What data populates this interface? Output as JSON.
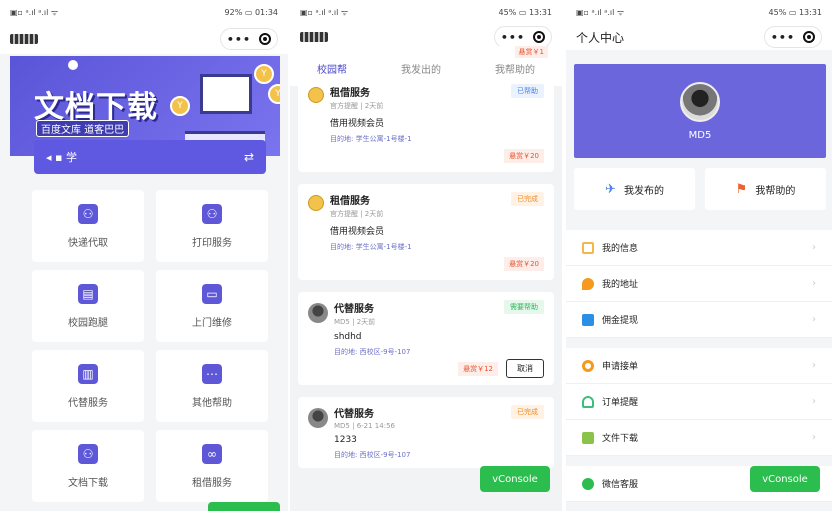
{
  "panel1": {
    "status_left": "▣▫ ᵃ.ıl ᵃ.ıl ᯤ",
    "status_right": "92% ▭ 01:34",
    "banner": {
      "title": "文档下载",
      "subtitle": "百度文库 道客巴巴",
      "coin": "Y"
    },
    "location": {
      "text": "学",
      "swap": "⇄"
    },
    "services": [
      {
        "label": "快递代取",
        "icon": "person-icon"
      },
      {
        "label": "打印服务",
        "icon": "person-icon"
      },
      {
        "label": "校园跑腿",
        "icon": "printer-icon"
      },
      {
        "label": "上门维修",
        "icon": "monitor-icon"
      },
      {
        "label": "代替服务",
        "icon": "book-icon"
      },
      {
        "label": "其他帮助",
        "icon": "more-icon"
      },
      {
        "label": "文档下载",
        "icon": "person-icon"
      },
      {
        "label": "租借服务",
        "icon": "glasses-icon"
      }
    ]
  },
  "panel2": {
    "status_left": "▣▫ ᵃ.ıl ᵃ.ıl ᯤ",
    "status_right": "45% ▭ 13:31",
    "tabs": [
      "校园帮",
      "我发出的",
      "我帮助的"
    ],
    "top_partial_badge": "悬赏￥1",
    "cards": [
      {
        "title": "租借服务",
        "sub": "官方提醒 | 2天前",
        "desc": "借用视频会员",
        "dest": "目的地: 学生公寓-1号楼-1",
        "status": "已帮助",
        "reward": "悬赏￥20"
      },
      {
        "title": "租借服务",
        "sub": "官方提醒 | 2天前",
        "desc": "借用视频会员",
        "dest": "目的地: 学生公寓-1号楼-1",
        "status": "已完成",
        "reward": "悬赏￥20"
      },
      {
        "title": "代替服务",
        "sub": "MD5 | 2天前",
        "desc": "shdhd",
        "dest": "目的地: 西校区-9号-107",
        "status": "需要帮助",
        "reward": "悬赏￥12",
        "action": "取消"
      },
      {
        "title": "代替服务",
        "sub": "MD5 | 6-21 14:56",
        "desc": "1233",
        "dest": "目的地: 西校区-9号-107",
        "status": "已完成"
      }
    ],
    "vconsole": "vConsole"
  },
  "panel3": {
    "status_left": "▣▫ ᵃ.ıl ᵃ.ıl ᯤ",
    "status_right": "45% ▭ 13:31",
    "title": "个人中心",
    "username": "MD5",
    "actions": [
      {
        "label": "我发布的",
        "icon": "✈"
      },
      {
        "label": "我帮助的",
        "icon": "⚑"
      }
    ],
    "menu_group1": [
      {
        "label": "我的信息",
        "color": "#f5b74b"
      },
      {
        "label": "我的地址",
        "color": "#f59a1e"
      },
      {
        "label": "佣金提现",
        "color": "#2b8fe6"
      }
    ],
    "menu_group2": [
      {
        "label": "申请接单",
        "color": "#f59a1e"
      },
      {
        "label": "订单提醒",
        "color": "#3cbf7a"
      },
      {
        "label": "文件下载",
        "color": "#8bc34a"
      }
    ],
    "menu_group3": [
      {
        "label": "微信客服",
        "color": "#2bbd4d"
      }
    ],
    "chevron": "›",
    "vconsole": "vConsole"
  }
}
